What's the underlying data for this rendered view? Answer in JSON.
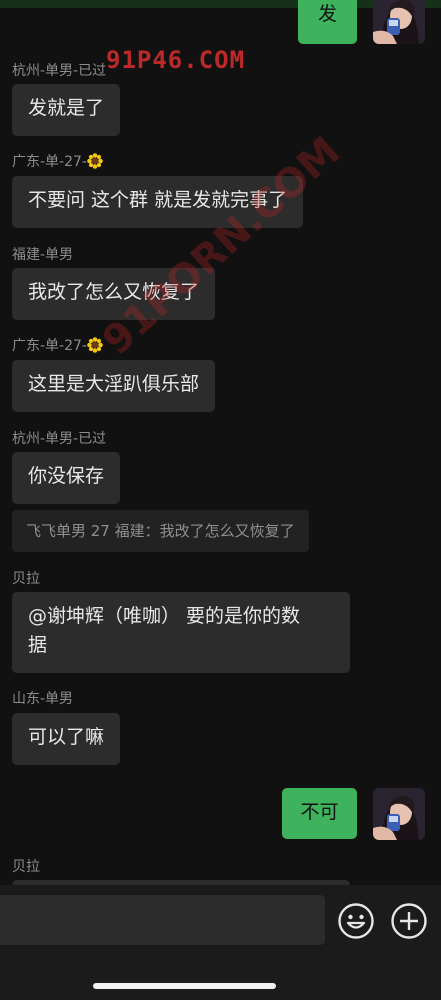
{
  "watermark": {
    "header_text": "91P46.COM",
    "diagonal_text": "91PORN.COM"
  },
  "messages": [
    {
      "type": "out",
      "text": "发"
    },
    {
      "type": "in",
      "sender": "杭州-单男-已过",
      "text": "发就是了"
    },
    {
      "type": "in",
      "sender": "广东-单-27-",
      "sender_emoji": "sunflower-icon",
      "text": "不要问 这个群 就是发就完事了"
    },
    {
      "type": "in",
      "sender": "福建-单男",
      "text": "我改了怎么又恢复了"
    },
    {
      "type": "in",
      "sender": "广东-单-27-",
      "sender_emoji": "sunflower-icon",
      "text": "这里是大淫趴俱乐部"
    },
    {
      "type": "in",
      "sender": "杭州-单男-已过",
      "text": "你没保存",
      "quote": "飞飞单男 27 福建：我改了怎么又恢复了"
    },
    {
      "type": "in",
      "sender": "贝拉",
      "text_line1": "@谢坤辉（唯咖） 要的是你的数",
      "text_line2": "据"
    },
    {
      "type": "in",
      "sender": "山东-单男",
      "text": "可以了嘛"
    },
    {
      "type": "out",
      "text": "不可"
    },
    {
      "type": "in",
      "sender": "贝拉",
      "text": ""
    }
  ],
  "input_bar": {
    "emoji_button": "smiley-face-icon",
    "more_button": "plus-circle-icon"
  },
  "colors": {
    "background": "#111111",
    "incoming_bubble": "#2c2c2c",
    "outgoing_bubble": "#3eb25c",
    "watermark": "#d22828"
  }
}
